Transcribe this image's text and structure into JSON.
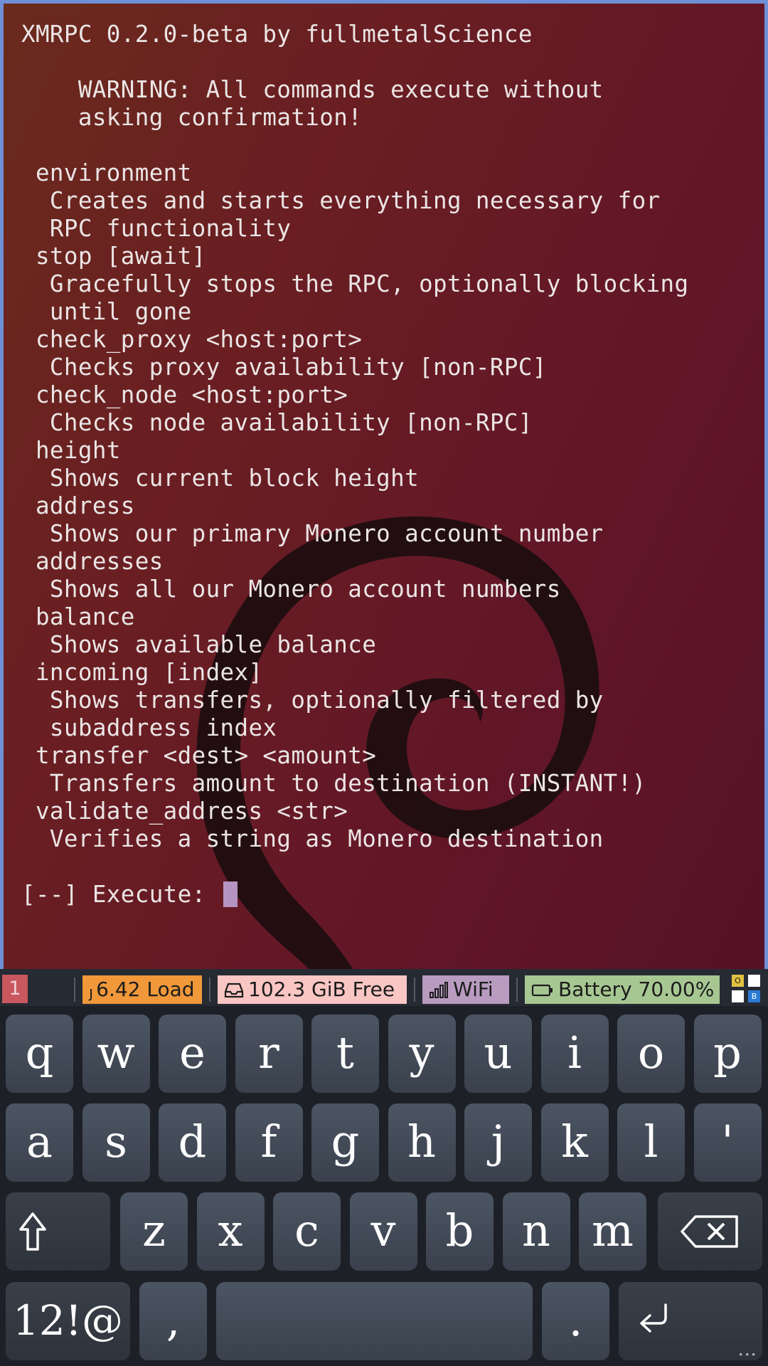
{
  "terminal": {
    "lines": [
      "XMRPC 0.2.0-beta by fullmetalScience",
      "",
      "    WARNING: All commands execute without",
      "    asking confirmation!",
      "",
      " environment",
      "  Creates and starts everything necessary for",
      "  RPC functionality",
      " stop [await]",
      "  Gracefully stops the RPC, optionally blocking",
      "  until gone",
      " check_proxy <host:port>",
      "  Checks proxy availability [non-RPC]",
      " check_node <host:port>",
      "  Checks node availability [non-RPC]",
      " height",
      "  Shows current block height",
      " address",
      "  Shows our primary Monero account number",
      " addresses",
      "  Shows all our Monero account numbers",
      " balance",
      "  Shows available balance",
      " incoming [index]",
      "  Shows transfers, optionally filtered by",
      "  subaddress index",
      " transfer <dest> <amount>",
      "  Transfers amount to destination (INSTANT!)",
      " validate_address <str>",
      "  Verifies a string as Monero destination",
      ""
    ],
    "prompt": "[--] Execute: "
  },
  "statusbar": {
    "workspace": "1",
    "load_prefix": "ȷ",
    "load": "6.42 Load",
    "disk": "102.3 GiB Free",
    "wifi": "WiFi",
    "battery": "Battery 70.00%",
    "tray": [
      "O",
      "B"
    ]
  },
  "keyboard": {
    "row1": [
      "q",
      "w",
      "e",
      "r",
      "t",
      "y",
      "u",
      "i",
      "o",
      "p"
    ],
    "row2": [
      "a",
      "s",
      "d",
      "f",
      "g",
      "h",
      "j",
      "k",
      "l",
      "'"
    ],
    "row3": [
      "z",
      "x",
      "c",
      "v",
      "b",
      "n",
      "m"
    ],
    "symbols": "12!@",
    "comma": ",",
    "period": ".",
    "more": "..."
  },
  "colors": {
    "terminal_border": "#6f8fd6",
    "focus_line": "#e2524f",
    "load": "#f0983a",
    "disk": "#fac6c3",
    "wifi": "#b99bc0",
    "battery": "#a7c792",
    "workspace": "#c9575f",
    "cursor": "#b594c2"
  }
}
